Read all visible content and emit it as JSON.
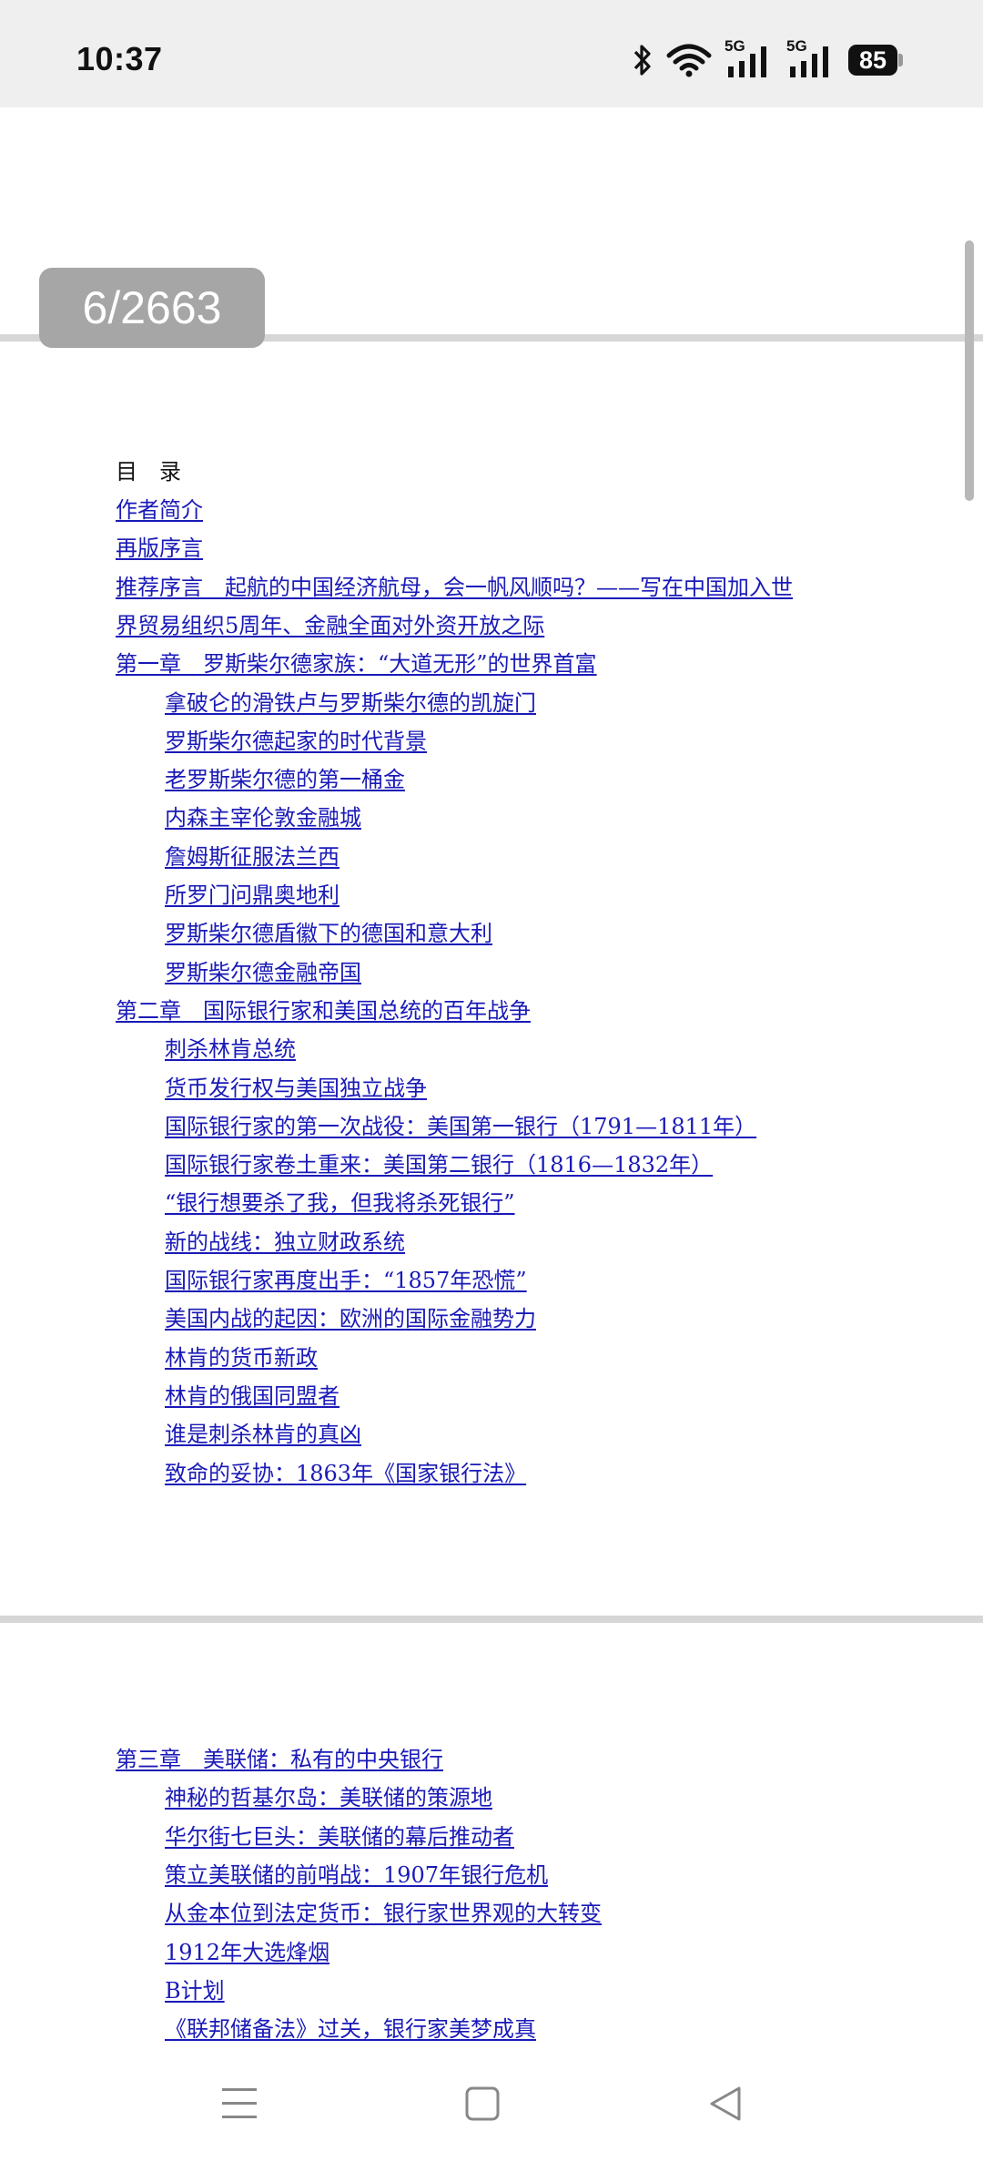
{
  "status_bar": {
    "time": "10:37",
    "battery": "85",
    "network_label_1": "5G",
    "network_label_2": "5G",
    "icons": [
      "bluetooth-icon",
      "wifi-icon",
      "signal-5g-icon",
      "signal-5g-icon",
      "battery-icon"
    ]
  },
  "reader": {
    "page_indicator": "6/2663"
  },
  "toc": {
    "heading": "目　录",
    "page1": [
      "作者简介",
      "再版序言",
      "推荐序言　起航的中国经济航母，会一帆风顺吗？——写在中国加入世",
      "界贸易组织5周年、金融全面对外资开放之际",
      "第一章　罗斯柴尔德家族：“大道无形”的世界首富",
      "拿破仑的滑铁卢与罗斯柴尔德的凯旋门",
      "罗斯柴尔德起家的时代背景",
      "老罗斯柴尔德的第一桶金",
      "内森主宰伦敦金融城",
      "詹姆斯征服法兰西",
      "所罗门问鼎奥地利",
      "罗斯柴尔德盾徽下的德国和意大利",
      "罗斯柴尔德金融帝国",
      "第二章　国际银行家和美国总统的百年战争",
      "刺杀林肯总统",
      "货币发行权与美国独立战争",
      "国际银行家的第一次战役：美国第一银行（1791—1811年）",
      "国际银行家卷土重来：美国第二银行（1816—1832年）",
      "“银行想要杀了我，但我将杀死银行”",
      "新的战线：独立财政系统",
      "国际银行家再度出手：“1857年恐慌”",
      "美国内战的起因：欧洲的国际金融势力",
      "林肯的货币新政",
      "林肯的俄国同盟者",
      "谁是刺杀林肯的真凶",
      "致命的妥协：1863年《国家银行法》"
    ],
    "page2": [
      "第三章　美联储：私有的中央银行",
      "神秘的哲基尔岛：美联储的策源地",
      "华尔街七巨头：美联储的幕后推动者",
      "策立美联储的前哨战：1907年银行危机",
      "从金本位到法定货币：银行家世界观的大转变",
      "1912年大选烽烟",
      "B计划",
      "《联邦储备法》过关，银行家美梦成真"
    ]
  },
  "nav_bar": {
    "icons": [
      "menu-icon",
      "home-icon",
      "back-icon"
    ]
  }
}
